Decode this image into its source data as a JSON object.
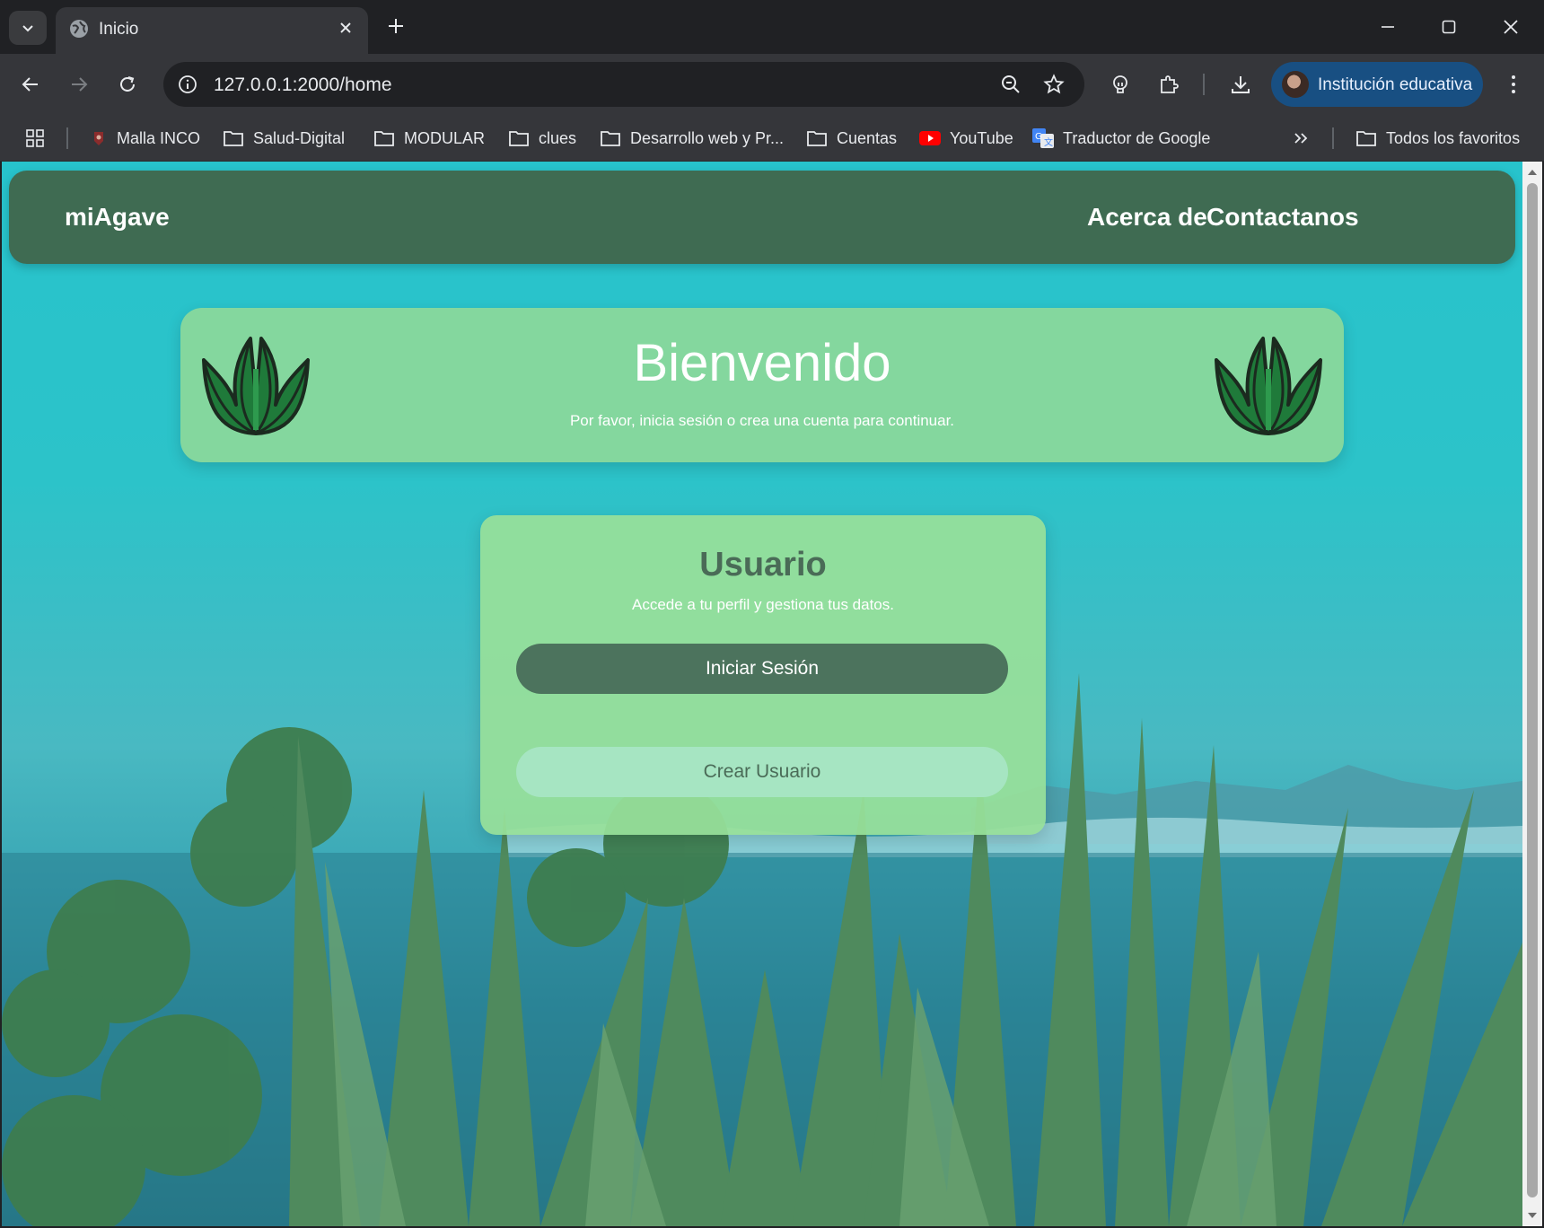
{
  "browser": {
    "tab": {
      "title": "Inicio"
    },
    "address_bar": {
      "url": "127.0.0.1:2000/home"
    },
    "profile": {
      "label": "Institución educativa"
    },
    "bookmarks": [
      {
        "label": "Malla INCO",
        "icon": "malla-favicon-icon"
      },
      {
        "label": "Salud-Digital",
        "icon": "folder-icon"
      },
      {
        "label": "MODULAR",
        "icon": "folder-icon"
      },
      {
        "label": "clues",
        "icon": "folder-icon"
      },
      {
        "label": "Desarrollo web y Pr...",
        "icon": "folder-icon"
      },
      {
        "label": "Cuentas",
        "icon": "folder-icon"
      },
      {
        "label": "YouTube",
        "icon": "youtube-icon"
      },
      {
        "label": "Traductor de Google",
        "icon": "google-translate-icon"
      }
    ],
    "all_bookmarks": {
      "label": "Todos los favoritos",
      "icon": "folder-icon"
    }
  },
  "page": {
    "header": {
      "brand": "miAgave",
      "links": [
        "Acerca de",
        "Contactanos"
      ]
    },
    "welcome": {
      "title": "Bienvenido",
      "subtitle": "Por favor, inicia sesión o crea una cuenta para continuar."
    },
    "user_card": {
      "title": "Usuario",
      "subtitle": "Accede a tu perfil y gestiona tus datos.",
      "login_button": "Iniciar Sesión",
      "create_button": "Crear Usuario"
    }
  },
  "colors": {
    "header_bg": "#3f6b52",
    "welcome_bg": "#84d79e",
    "card_bg": "#98e09a",
    "login_button_bg": "#4c735d",
    "create_button_bg": "#a6e5c2",
    "page_bg_top": "#27c3cc"
  }
}
